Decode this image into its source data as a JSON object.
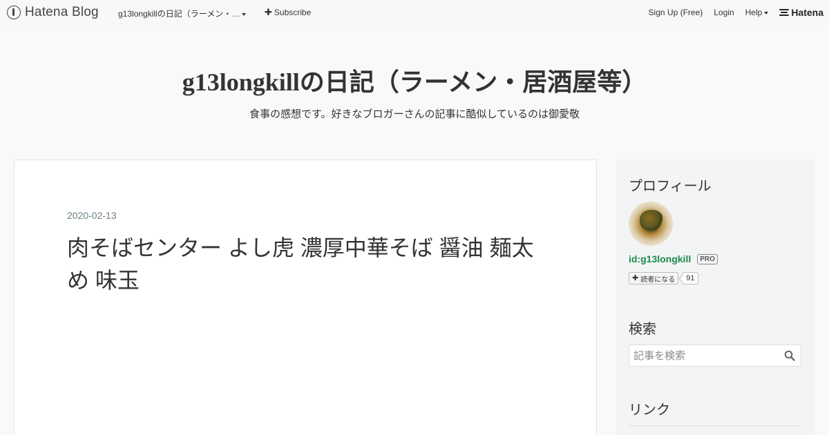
{
  "global_header": {
    "logo_text": "Hatena Blog",
    "blog_name": "g13longkillの日記（ラーメン・…",
    "subscribe_label": "Subscribe",
    "signup_label": "Sign Up (Free)",
    "login_label": "Login",
    "help_label": "Help",
    "hatena_label": "Hatena"
  },
  "blog": {
    "title": "g13longkillの日記（ラーメン・居酒屋等）",
    "description": "食事の感想です。好きなブロガーさんの記事に酷似しているのは御愛敬"
  },
  "entry": {
    "date": "2020-02-13",
    "title": "肉そばセンター よし虎 濃厚中華そば 醤油 麺太め 味玉"
  },
  "sidebar": {
    "profile": {
      "heading": "プロフィール",
      "user_id": "id:g13longkill",
      "badge": "PRO",
      "reader_button_label": "読者になる",
      "reader_count": "91"
    },
    "search": {
      "heading": "検索",
      "placeholder": "記事を検索"
    },
    "links": {
      "heading": "リンク"
    }
  },
  "colors": {
    "page_background": "#f8f9fa",
    "user_link": "#1a8a4a",
    "date_text": "#6d7f8a"
  }
}
